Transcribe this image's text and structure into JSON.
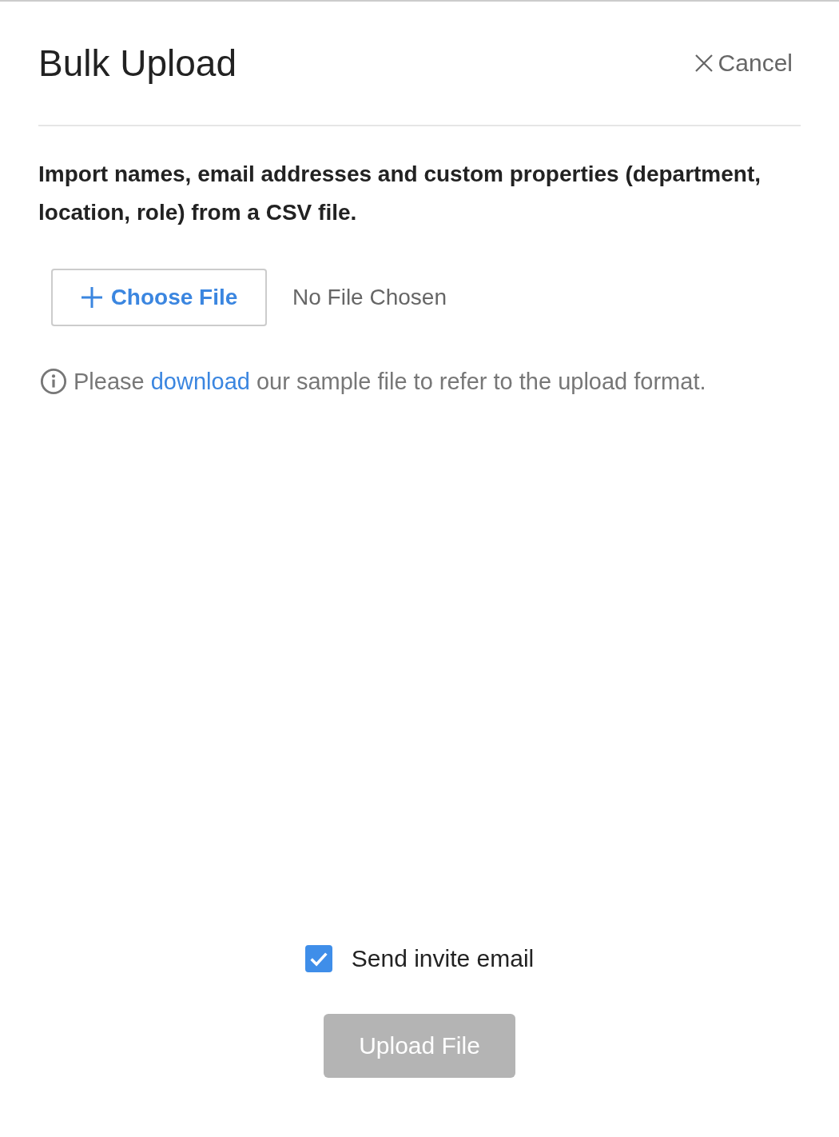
{
  "dialog": {
    "title": "Bulk Upload",
    "cancel": {
      "label": "Cancel"
    }
  },
  "description": "Import names, email addresses and custom properties (department, location, role) from a CSV file.",
  "file_picker": {
    "button": "Choose File",
    "status": "No File Chosen"
  },
  "info": {
    "before": "Please",
    "link": "download",
    "after": "our sample file to refer to the upload format."
  },
  "send_invite": {
    "label": "Send invite email",
    "checked": true
  },
  "upload_button": {
    "label": "Upload File",
    "disabled": true
  }
}
